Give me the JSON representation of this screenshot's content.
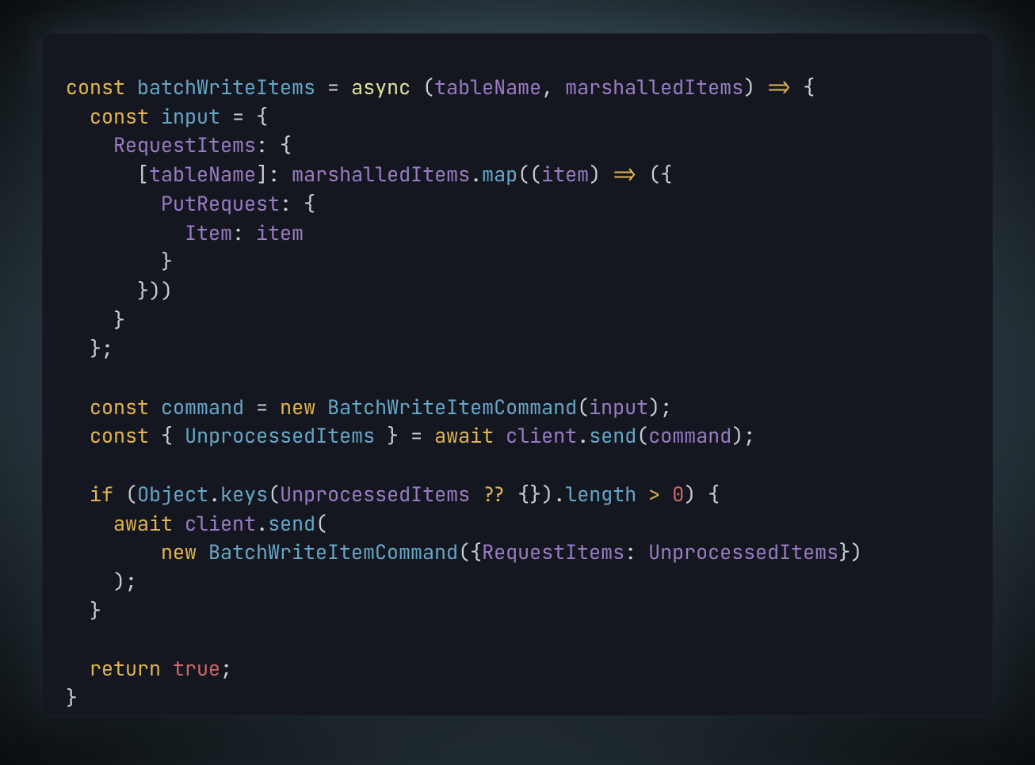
{
  "code": {
    "colors": {
      "keyword": "#e2b652",
      "identifier_teal": "#67a7c8",
      "identifier_purple": "#9b7cc3",
      "async": "#e0e39a",
      "punctuation": "#c9cfd6",
      "number": "#cf6868",
      "boolean": "#cf6868",
      "background": "#141720"
    },
    "language": "javascript",
    "tokens": {
      "const": "const",
      "batchWriteItems": "batchWriteItems",
      "eq": " = ",
      "async": "async",
      "sp": " ",
      "lp": "(",
      "tableName": "tableName",
      "comma": ", ",
      "marshalledItems": "marshalledItems",
      "rp": ")",
      "arrow": " => ",
      "lb": "{",
      "rb": "}",
      "input": "input",
      "RequestItems": "RequestItems",
      "colon": ": ",
      "lbr": "[",
      "rbr": "]",
      "map": "map",
      "dot": ".",
      "item": "item",
      "PutRequest": "PutRequest",
      "Item": "Item",
      "semi": ";",
      "command": "command",
      "new": "new",
      "BatchWriteItemCommand": "BatchWriteItemCommand",
      "UnprocessedItems": "UnprocessedItems",
      "await": "await",
      "client": "client",
      "send": "send",
      "if": "if",
      "Object": "Object",
      "keys": "keys",
      "qq": " ?? ",
      "length": "length",
      "gt": " > ",
      "zero": "0",
      "return": "return",
      "true": "true"
    }
  }
}
